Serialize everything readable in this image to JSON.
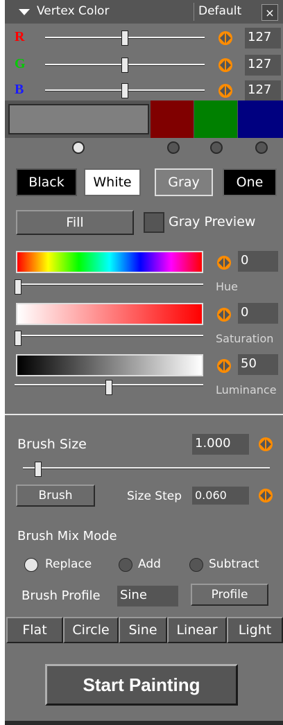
{
  "header": {
    "title": "Vertex Color",
    "preset": "Default",
    "close_glyph": "×"
  },
  "channels": [
    {
      "letter": "R",
      "color": "#ff0000",
      "value": "127",
      "level": 127
    },
    {
      "letter": "G",
      "color": "#00cc00",
      "value": "127",
      "level": 127
    },
    {
      "letter": "B",
      "color": "#1a1aff",
      "value": "127",
      "level": 127
    }
  ],
  "swatches": {
    "current": "#7f7f7f",
    "red": "#800000",
    "green": "#008000",
    "blue": "#000080"
  },
  "preset_buttons": {
    "black": "Black",
    "white": "White",
    "gray": "Gray",
    "one": "One"
  },
  "fill": {
    "label": "Fill",
    "gray_preview_label": "Gray Preview",
    "gray_preview_checked": false
  },
  "hsl": {
    "hue": {
      "value": "0",
      "label": "Hue",
      "level": 0
    },
    "saturation": {
      "value": "0",
      "label": "Saturation",
      "level": 0
    },
    "luminance": {
      "value": "50",
      "label": "Luminance",
      "level": 50
    }
  },
  "brush": {
    "size_label": "Brush Size",
    "size_value": "1.000",
    "size_level": 0.05,
    "brush_button": "Brush",
    "size_step_label": "Size Step",
    "size_step_value": "0.060",
    "mix_mode_label": "Brush Mix Mode",
    "mix_modes": [
      "Replace",
      "Add",
      "Subtract"
    ],
    "mix_mode_selected": "Replace",
    "profile_label": "Brush Profile",
    "profile_value": "Sine",
    "profile_button": "Profile"
  },
  "profiles": [
    "Flat",
    "Circle",
    "Sine",
    "Linear",
    "Light"
  ],
  "start_button": "Start Painting",
  "colors": {
    "accent_orange": "#ff8c00",
    "panel_bg": "#727272"
  }
}
